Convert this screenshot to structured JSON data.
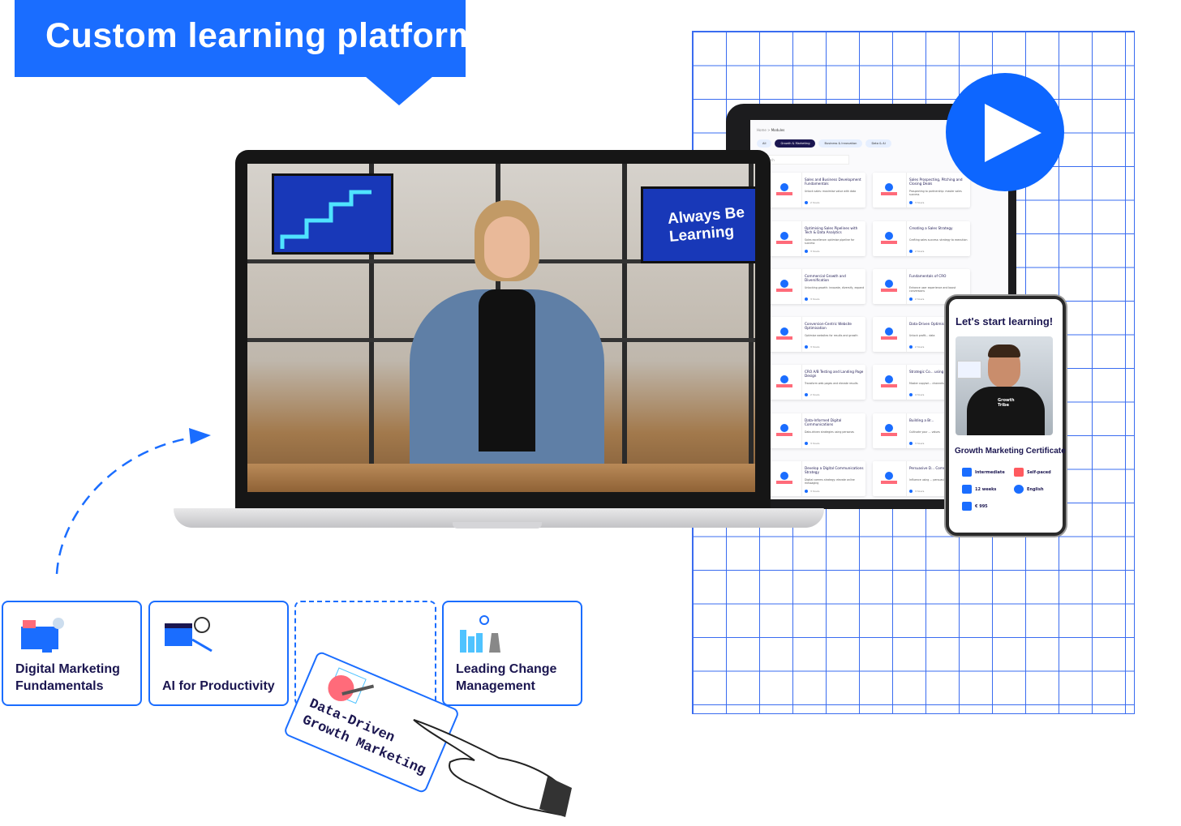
{
  "banner": {
    "title": "Custom learning platform",
    "color": "#1a6dff"
  },
  "tablet": {
    "breadcrumb": [
      "Home",
      ">",
      "Modules"
    ],
    "tabs": [
      {
        "label": "All"
      },
      {
        "label": "Growth & Marketing",
        "active": true
      },
      {
        "label": "Business & Innovation"
      },
      {
        "label": "Data & AI"
      }
    ],
    "search_placeholder": "Search",
    "modules_left": [
      {
        "title": "Sales and Business Development Fundamentals",
        "desc": "Unlock sales: maximise value with data",
        "duration": "2 hours"
      },
      {
        "title": "Optimising Sales Pipelines with Tech & Data Analytics",
        "desc": "Sales excellence: optimise pipeline for success",
        "duration": "3 hours"
      },
      {
        "title": "Commercial Growth and Diversification",
        "desc": "Unlocking growth: innovate, diversify, expand",
        "duration": "3 hours"
      },
      {
        "title": "Conversion-Centric Website Optimisation",
        "desc": "Optimise websites for results and growth",
        "duration": "3 hours"
      },
      {
        "title": "CRO A/B Testing and Landing Page Design",
        "desc": "Transform web pages and elevate results",
        "duration": "2 hours"
      },
      {
        "title": "Data-Informed Digital Communications",
        "desc": "Data-driven strategies using personas",
        "duration": "3 hours"
      },
      {
        "title": "Develop a Digital Communications Strategy",
        "desc": "Digital comms strategy: elevate online messaging",
        "duration": "3 hours"
      }
    ],
    "modules_right": [
      {
        "title": "Sales Prospecting, Pitching and Closing Deals",
        "desc": "Prospecting to partnership: master sales success",
        "duration": "3 hours"
      },
      {
        "title": "Creating a Sales Strategy",
        "desc": "Crafting sales success: strategy to execution",
        "duration": "2 hours"
      },
      {
        "title": "Fundamentals of CRO",
        "desc": "Enhance user experience and boost conversions",
        "duration": "2 hours"
      },
      {
        "title": "Data-Driven Optimisation",
        "desc": "Unlock profit... data",
        "duration": "2 hours"
      },
      {
        "title": "Strategic Co... using Innova...",
        "desc": "Master copywri... channels",
        "duration": "4 hours"
      },
      {
        "title": "Building a Br...",
        "desc": "Cultivate your ... values",
        "duration": "3 hours"
      },
      {
        "title": "Persuasive D... Communicat...",
        "desc": "Influence using ... persuasion",
        "duration": "3 hours"
      }
    ]
  },
  "laptop": {
    "tv_text": "Always Be Learning"
  },
  "phone": {
    "heading": "Let's start learning!",
    "shirt_logo": "Growth Tribe",
    "course": "Growth Marketing Certificate",
    "facts": [
      {
        "icon": "bar-chart-icon",
        "label": "Intermediate"
      },
      {
        "icon": "runner-icon",
        "label": "Self-paced"
      },
      {
        "icon": "calendar-icon",
        "label": "12 weeks"
      },
      {
        "icon": "globe-icon",
        "label": "English"
      },
      {
        "icon": "wallet-icon",
        "label": "€ 995"
      }
    ]
  },
  "cards": [
    {
      "label": "Digital Marketing Fundamentals"
    },
    {
      "label": "AI for Productivity"
    },
    {
      "label": "Data-Driven Growth Marketing"
    },
    {
      "label": "Leading Change Management"
    }
  ]
}
